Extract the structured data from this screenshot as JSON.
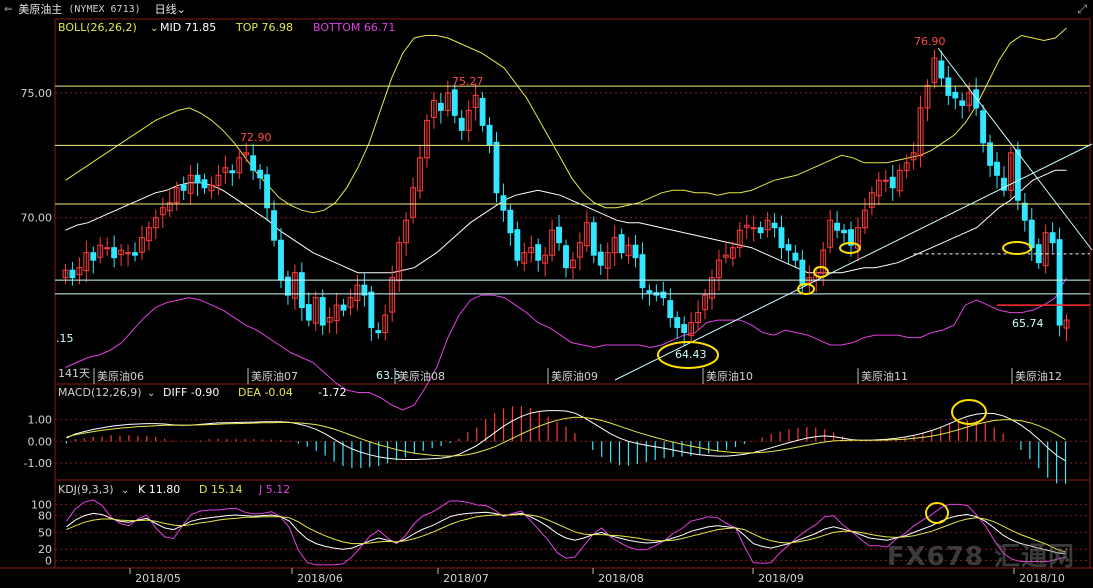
{
  "titlebar": {
    "symbol": "美原油主",
    "code": "(NYMEX 6713)",
    "period": "日线",
    "dropdown_icon": "chevron-down-icon",
    "back_icon": "back-arrow-icon",
    "expand_icon": "expand-icon"
  },
  "colors": {
    "background": "#000000",
    "up": "#ff3b3b",
    "down": "#33e6ff",
    "boll_mid": "#ffffff",
    "boll_top": "#e6e64a",
    "boll_bottom": "#e040e0",
    "axis_text": "#d0d0d0",
    "price_annot": "#ff4a4a",
    "hline": "#f0f080",
    "support": "#ccffff",
    "circle": "#ffe000"
  },
  "chart_data": [
    {
      "type": "candlestick",
      "title": "美原油主",
      "indicator_label": "BOLL(26,26,2)",
      "mid_label": "MID",
      "mid_value": "71.85",
      "top_label": "TOP",
      "top_value": "76.98",
      "bottom_label": "BOTTOM",
      "bottom_value": "66.71",
      "ylim": [
        63.5,
        77.8
      ],
      "y_ticks": [
        "75.00",
        "70.00"
      ],
      "y_tick_values": [
        75.0,
        70.0
      ],
      "x_date_labels": [
        "2018/05",
        "2018/06",
        "2018/07",
        "2018/08",
        "2018/09",
        "2018/10"
      ],
      "contract_labels": [
        "美原油06",
        "美原油07",
        "美原油08",
        "美原油09",
        "美原油10",
        "美原油11",
        "美原油12"
      ],
      "days_label": "141天",
      "annotations": [
        "72.90",
        "75.27",
        "64.43",
        "76.90",
        "65.74",
        "63.5",
        ".15"
      ],
      "closes": [
        67.9,
        67.6,
        68.0,
        68.6,
        68.3,
        68.9,
        68.8,
        68.4,
        68.7,
        68.6,
        68.5,
        69.2,
        69.6,
        70.0,
        70.4,
        70.6,
        71.2,
        71.1,
        71.7,
        71.4,
        71.2,
        71.3,
        71.7,
        72.0,
        71.8,
        72.4,
        72.6,
        71.9,
        71.6,
        70.4,
        69.1,
        67.5,
        66.9,
        67.8,
        66.4,
        65.9,
        66.8,
        65.7,
        66.0,
        66.5,
        66.3,
        66.8,
        67.3,
        66.9,
        65.6,
        65.4,
        66.1,
        67.6,
        69.0,
        69.9,
        71.2,
        72.4,
        73.9,
        74.7,
        74.3,
        75.0,
        74.1,
        73.5,
        74.3,
        74.9,
        73.7,
        72.9,
        71.0,
        70.3,
        69.4,
        68.3,
        68.6,
        68.8,
        68.3,
        68.5,
        69.5,
        69.0,
        68.0,
        68.3,
        69.0,
        69.8,
        68.5,
        68.1,
        68.6,
        69.2,
        68.6,
        68.9,
        68.4,
        67.2,
        67.0,
        66.9,
        66.8,
        66.0,
        65.6,
        65.4,
        65.8,
        66.2,
        66.9,
        67.6,
        68.3,
        68.5,
        68.8,
        69.5,
        69.7,
        69.6,
        69.4,
        69.9,
        69.6,
        68.8,
        68.7,
        68.3,
        67.3,
        67.6,
        67.8,
        68.7,
        69.9,
        69.5,
        69.4,
        68.9,
        69.6,
        70.3,
        71.0,
        71.5,
        71.5,
        71.2,
        71.9,
        72.2,
        72.6,
        74.4,
        75.3,
        76.4,
        75.6,
        74.9,
        74.8,
        74.5,
        75.0,
        74.4,
        73.0,
        72.1,
        71.7,
        71.1,
        72.6,
        70.7,
        69.9,
        68.8,
        68.2,
        69.4,
        69.0,
        65.7,
        65.9
      ],
      "boll_mid": [
        69.5,
        69.7,
        69.8,
        70.0,
        70.2,
        70.4,
        70.6,
        70.8,
        71.0,
        71.1,
        71.3,
        71.4,
        71.4,
        71.3,
        71.1,
        70.8,
        70.5,
        70.2,
        69.9,
        69.5,
        69.2,
        68.9,
        68.6,
        68.4,
        68.2,
        68.0,
        67.8,
        67.8,
        67.8,
        67.8,
        67.9,
        68.0,
        68.3,
        68.6,
        69.0,
        69.4,
        69.8,
        70.1,
        70.4,
        70.7,
        70.9,
        71.0,
        71.1,
        71.0,
        70.9,
        70.7,
        70.5,
        70.3,
        70.1,
        69.9,
        69.8,
        69.8,
        69.7,
        69.6,
        69.5,
        69.4,
        69.3,
        69.2,
        69.1,
        69.0,
        68.9,
        68.8,
        68.6,
        68.4,
        68.2,
        68.0,
        67.8,
        67.8,
        67.8,
        67.8,
        67.9,
        68.0,
        68.0,
        68.1,
        68.2,
        68.4,
        68.6,
        68.8,
        69.0,
        69.2,
        69.4,
        69.6,
        70.0,
        70.4,
        70.7,
        71.1,
        71.5,
        71.7,
        71.9,
        71.9
      ],
      "boll_top": [
        71.5,
        71.8,
        72.1,
        72.4,
        72.7,
        73.0,
        73.3,
        73.6,
        73.9,
        74.1,
        74.3,
        74.4,
        74.2,
        73.9,
        73.5,
        73.0,
        72.4,
        71.8,
        71.3,
        70.8,
        70.5,
        70.3,
        70.2,
        70.3,
        70.6,
        71.2,
        72.0,
        73.0,
        74.3,
        75.6,
        76.6,
        77.2,
        77.3,
        77.3,
        77.2,
        77.0,
        76.8,
        76.6,
        76.3,
        76.0,
        75.4,
        74.8,
        74.0,
        73.2,
        72.4,
        71.6,
        71.0,
        70.6,
        70.4,
        70.4,
        70.5,
        70.6,
        70.8,
        71.0,
        71.1,
        71.1,
        71.0,
        71.0,
        70.9,
        71.0,
        71.0,
        71.1,
        71.3,
        71.5,
        71.6,
        71.7,
        71.9,
        72.1,
        72.3,
        72.5,
        72.4,
        72.2,
        72.2,
        72.2,
        72.3,
        72.4,
        72.5,
        72.7,
        73.0,
        73.3,
        73.8,
        74.5,
        75.4,
        76.3,
        77.0,
        77.3,
        77.2,
        77.1,
        77.2,
        77.6
      ],
      "boll_bottom": [
        64.0,
        64.2,
        64.4,
        64.5,
        64.7,
        65.0,
        65.5,
        66.0,
        66.4,
        66.6,
        66.7,
        66.8,
        66.7,
        66.5,
        66.3,
        66.0,
        65.7,
        65.5,
        65.2,
        64.9,
        64.6,
        64.4,
        64.2,
        63.8,
        63.4,
        63.1,
        63.0,
        63.0,
        62.8,
        62.5,
        62.3,
        62.5,
        63.2,
        64.0,
        65.2,
        66.1,
        66.7,
        66.9,
        66.9,
        66.8,
        66.5,
        66.2,
        65.8,
        65.6,
        65.3,
        65.0,
        64.9,
        64.8,
        64.9,
        64.9,
        64.9,
        64.9,
        64.8,
        64.9,
        65.1,
        65.3,
        65.4,
        65.8,
        65.9,
        65.9,
        65.9,
        65.7,
        65.4,
        65.3,
        65.5,
        65.4,
        65.3,
        65.1,
        64.9,
        64.9,
        65.0,
        65.2,
        65.3,
        65.3,
        65.3,
        65.2,
        65.2,
        65.4,
        65.5,
        65.7,
        66.5,
        66.7,
        66.5,
        66.3,
        66.2,
        66.2,
        66.3,
        66.5,
        66.8,
        67.6
      ]
    },
    {
      "type": "line",
      "title": "MACD(12,26,9)",
      "series": [
        {
          "name": "DIFF",
          "value_text": "-0.90"
        },
        {
          "name": "DEA",
          "value_text": "-0.04"
        }
      ],
      "macd_text": "-1.72",
      "y_ticks": [
        "1.00",
        "0.00",
        "-1.00"
      ],
      "y_tick_values": [
        1.0,
        0.0,
        -1.0
      ],
      "ylim": [
        -1.6,
        2.0
      ],
      "diff": [
        0.15,
        0.35,
        0.45,
        0.55,
        0.62,
        0.7,
        0.74,
        0.78,
        0.8,
        0.82,
        0.82,
        0.8,
        0.76,
        0.74,
        0.75,
        0.78,
        0.82,
        0.85,
        0.86,
        0.87,
        0.88,
        0.89,
        0.9,
        0.9,
        0.9,
        0.88,
        0.8,
        0.7,
        0.55,
        0.35,
        0.1,
        -0.15,
        -0.35,
        -0.5,
        -0.62,
        -0.72,
        -0.78,
        -0.82,
        -0.84,
        -0.84,
        -0.82,
        -0.8,
        -0.78,
        -0.72,
        -0.6,
        -0.4,
        -0.2,
        0.1,
        0.4,
        0.7,
        0.95,
        1.15,
        1.3,
        1.38,
        1.42,
        1.42,
        1.4,
        1.3,
        1.1,
        0.85,
        0.6,
        0.35,
        0.15,
        0.0,
        -0.1,
        -0.18,
        -0.25,
        -0.32,
        -0.4,
        -0.48,
        -0.56,
        -0.62,
        -0.66,
        -0.68,
        -0.68,
        -0.65,
        -0.6,
        -0.52,
        -0.42,
        -0.3,
        -0.18,
        -0.06,
        0.05,
        0.15,
        0.22,
        0.25,
        0.22,
        0.15,
        0.08,
        0.05,
        0.05,
        0.07,
        0.1,
        0.14,
        0.2,
        0.28,
        0.38,
        0.5,
        0.65,
        0.82,
        1.0,
        1.15,
        1.25,
        1.3,
        1.28,
        1.18,
        1.0,
        0.75,
        0.45,
        0.1,
        -0.3,
        -0.65,
        -0.9
      ],
      "dea": [
        0.2,
        0.3,
        0.38,
        0.45,
        0.51,
        0.56,
        0.61,
        0.64,
        0.68,
        0.7,
        0.72,
        0.74,
        0.74,
        0.74,
        0.75,
        0.76,
        0.77,
        0.79,
        0.81,
        0.82,
        0.83,
        0.84,
        0.86,
        0.86,
        0.87,
        0.87,
        0.85,
        0.82,
        0.77,
        0.68,
        0.57,
        0.42,
        0.27,
        0.12,
        -0.02,
        -0.15,
        -0.27,
        -0.38,
        -0.47,
        -0.55,
        -0.6,
        -0.64,
        -0.67,
        -0.68,
        -0.66,
        -0.61,
        -0.52,
        -0.4,
        -0.25,
        -0.06,
        0.14,
        0.34,
        0.53,
        0.7,
        0.85,
        0.97,
        1.06,
        1.11,
        1.1,
        1.05,
        0.96,
        0.84,
        0.7,
        0.56,
        0.42,
        0.3,
        0.18,
        0.07,
        -0.04,
        -0.13,
        -0.22,
        -0.3,
        -0.38,
        -0.44,
        -0.49,
        -0.52,
        -0.54,
        -0.53,
        -0.51,
        -0.47,
        -0.41,
        -0.34,
        -0.26,
        -0.18,
        -0.1,
        -0.03,
        0.02,
        0.04,
        0.05,
        0.05,
        0.05,
        0.05,
        0.06,
        0.08,
        0.1,
        0.14,
        0.18,
        0.24,
        0.32,
        0.42,
        0.54,
        0.66,
        0.78,
        0.88,
        0.96,
        1.0,
        1.0,
        0.95,
        0.86,
        0.72,
        0.54,
        0.32,
        0.08
      ]
    },
    {
      "type": "line",
      "title": "KDJ(9,3,3)",
      "series": [
        {
          "name": "K",
          "value_text": "11.80"
        },
        {
          "name": "D",
          "value_text": "15.14"
        },
        {
          "name": "J",
          "value_text": "5.12"
        }
      ],
      "y_ticks": [
        "100",
        "80",
        "50",
        "20",
        "0"
      ],
      "y_tick_values": [
        100,
        80,
        50,
        20,
        0
      ],
      "ylim": [
        -10,
        115
      ],
      "k": [
        60,
        72,
        80,
        84,
        82,
        75,
        70,
        68,
        72,
        75,
        66,
        58,
        55,
        62,
        70,
        74,
        76,
        78,
        80,
        81,
        80,
        79,
        80,
        81,
        78,
        70,
        52,
        38,
        30,
        25,
        22,
        20,
        22,
        28,
        35,
        40,
        36,
        32,
        38,
        48,
        56,
        62,
        70,
        78,
        82,
        84,
        85,
        86,
        84,
        80,
        82,
        84,
        78,
        70,
        60,
        48,
        40,
        36,
        40,
        46,
        50,
        44,
        40,
        36,
        33,
        31,
        32,
        35,
        40,
        45,
        52,
        56,
        60,
        62,
        60,
        58,
        45,
        30,
        25,
        22,
        26,
        30,
        36,
        42,
        48,
        56,
        60,
        56,
        52,
        46,
        40,
        38,
        36,
        40,
        44,
        50,
        56,
        62,
        70,
        76,
        80,
        82,
        78,
        70,
        58,
        45,
        36,
        30,
        26,
        22,
        18,
        14,
        12
      ],
      "d": [
        55,
        62,
        68,
        72,
        74,
        74,
        72,
        71,
        71,
        72,
        70,
        66,
        63,
        62,
        64,
        67,
        69,
        72,
        74,
        75,
        77,
        77,
        78,
        78,
        78,
        76,
        69,
        59,
        51,
        44,
        38,
        33,
        30,
        30,
        31,
        33,
        34,
        33,
        35,
        39,
        44,
        50,
        57,
        64,
        70,
        74,
        78,
        80,
        81,
        81,
        81,
        82,
        81,
        78,
        72,
        65,
        58,
        51,
        47,
        46,
        46,
        45,
        44,
        42,
        40,
        37,
        35,
        35,
        36,
        39,
        43,
        47,
        51,
        55,
        57,
        58,
        55,
        47,
        40,
        35,
        32,
        31,
        33,
        36,
        40,
        45,
        50,
        52,
        52,
        50,
        47,
        44,
        42,
        41,
        42,
        44,
        48,
        52,
        58,
        64,
        70,
        74,
        76,
        74,
        69,
        61,
        53,
        46,
        40,
        34,
        28,
        20,
        15
      ]
    }
  ],
  "watermark": "FX678 汇通网"
}
